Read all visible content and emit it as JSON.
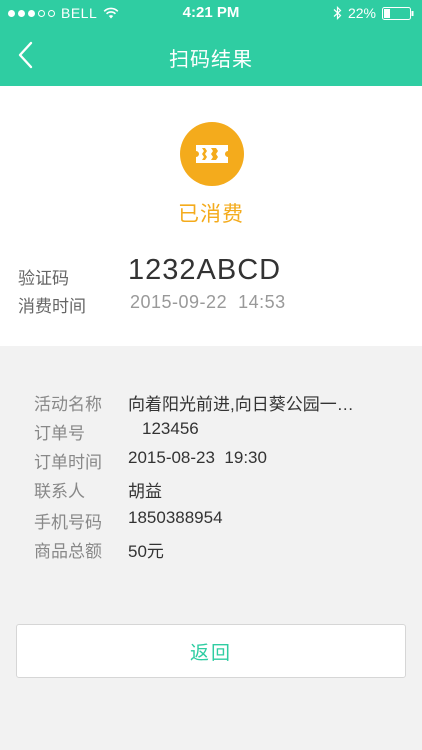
{
  "status_bar": {
    "carrier": "BELL",
    "time": "4:21 PM",
    "battery": "22%"
  },
  "nav": {
    "title": "扫码结果",
    "back_icon": "chevron-left-icon"
  },
  "result": {
    "status_icon": "ticket-icon",
    "status_label": "已消费",
    "code_label": "验证码",
    "code_value": "1232ABCD",
    "time_label": "消费时间",
    "time_value": "2015-09-22  14:53"
  },
  "details": [
    {
      "label": "活动名称",
      "value": "向着阳光前进,向日葵公园一…"
    },
    {
      "label": "订单号",
      "value": "123456"
    },
    {
      "label": "订单时间",
      "value": "2015-08-23  19:30"
    },
    {
      "label": "联系人",
      "value": "胡益"
    },
    {
      "label": "手机号码",
      "value": "1850388954"
    },
    {
      "label": "商品总额",
      "value": "50元"
    }
  ],
  "actions": {
    "back_label": "返回"
  },
  "colors": {
    "brand": "#2fcda2",
    "status": "#f4ab1c"
  }
}
